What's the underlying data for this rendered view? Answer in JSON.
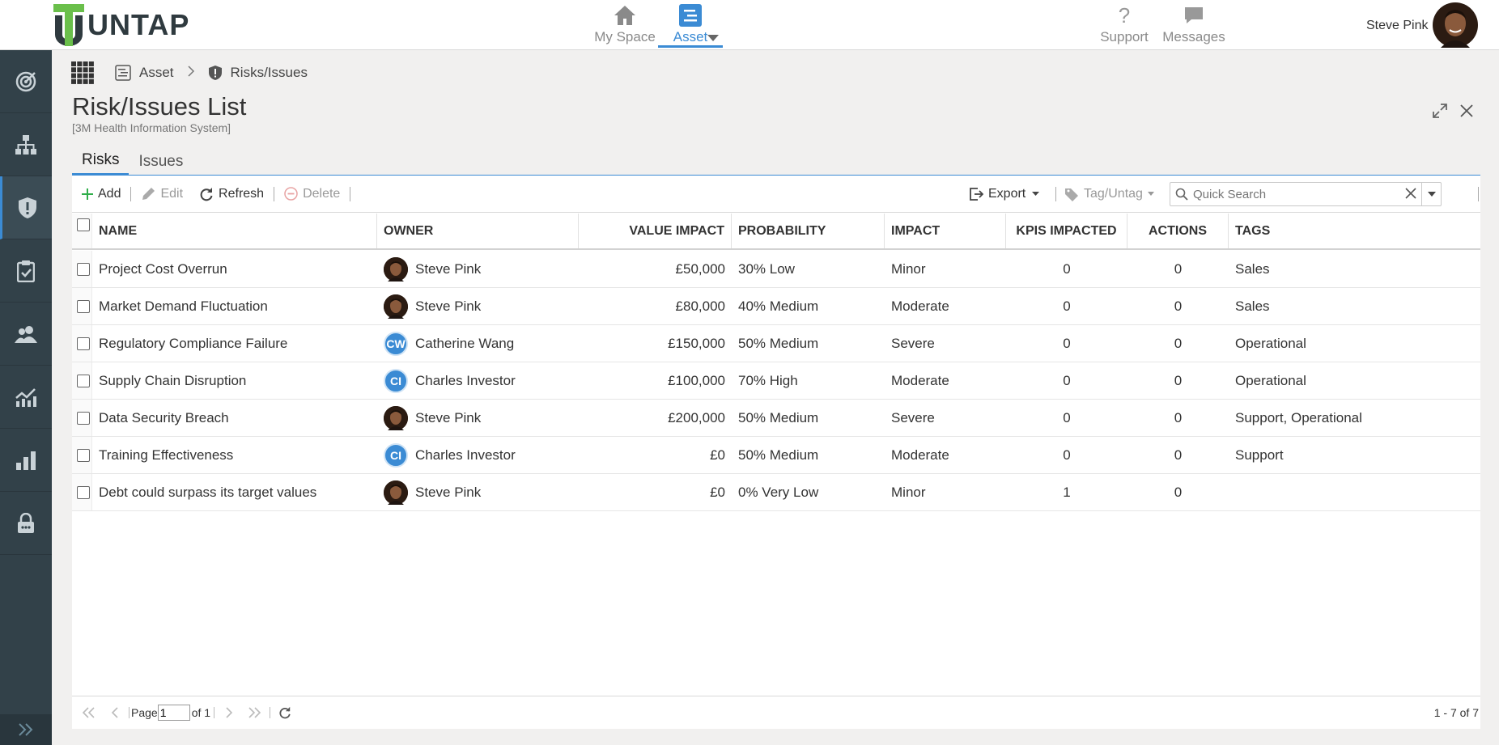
{
  "app": {
    "logo_text": "UNTAP"
  },
  "topnav": {
    "my_space": "My Space",
    "asset": "Asset",
    "support": "Support",
    "messages": "Messages"
  },
  "user": {
    "name": "Steve Pink"
  },
  "breadcrumb": {
    "level1": "Asset",
    "level2": "Risks/Issues"
  },
  "page": {
    "title": "Risk/Issues List",
    "subtitle": "[3M Health Information System]"
  },
  "tabs": [
    {
      "label": "Risks"
    },
    {
      "label": "Issues"
    }
  ],
  "toolbar": {
    "add": "Add",
    "edit": "Edit",
    "refresh": "Refresh",
    "delete": "Delete",
    "export": "Export",
    "tag_untag": "Tag/Untag",
    "search_placeholder": "Quick Search"
  },
  "columns": {
    "name": "NAME",
    "owner": "OWNER",
    "value_impact": "VALUE IMPACT",
    "probability": "PROBABILITY",
    "impact": "IMPACT",
    "kpis_impacted": "KPIS IMPACTED",
    "actions": "ACTIONS",
    "tags": "TAGS"
  },
  "rows": [
    {
      "name": "Project Cost Overrun",
      "owner": "Steve Pink",
      "owner_avatar": "photo",
      "value_impact": "£50,000",
      "probability": "30% Low",
      "impact": "Minor",
      "kpis": "0",
      "actions": "0",
      "tags": "Sales"
    },
    {
      "name": "Market Demand Fluctuation",
      "owner": "Steve Pink",
      "owner_avatar": "photo",
      "value_impact": "£80,000",
      "probability": "40% Medium",
      "impact": "Moderate",
      "kpis": "0",
      "actions": "0",
      "tags": "Sales"
    },
    {
      "name": "Regulatory Compliance Failure",
      "owner": "Catherine Wang",
      "owner_avatar": "CW",
      "value_impact": "£150,000",
      "probability": "50% Medium",
      "impact": "Severe",
      "kpis": "0",
      "actions": "0",
      "tags": "Operational"
    },
    {
      "name": "Supply Chain Disruption",
      "owner": "Charles Investor",
      "owner_avatar": "CI",
      "value_impact": "£100,000",
      "probability": "70% High",
      "impact": "Moderate",
      "kpis": "0",
      "actions": "0",
      "tags": "Operational"
    },
    {
      "name": "Data Security Breach",
      "owner": "Steve Pink",
      "owner_avatar": "photo",
      "value_impact": "£200,000",
      "probability": "50% Medium",
      "impact": "Severe",
      "kpis": "0",
      "actions": "0",
      "tags": "Support, Operational"
    },
    {
      "name": "Training Effectiveness",
      "owner": "Charles Investor",
      "owner_avatar": "CI",
      "value_impact": "£0",
      "probability": "50% Medium",
      "impact": "Moderate",
      "kpis": "0",
      "actions": "0",
      "tags": "Support"
    },
    {
      "name": "Debt could surpass its target values",
      "owner": "Steve Pink",
      "owner_avatar": "photo",
      "value_impact": "£0",
      "probability": "0% Very Low",
      "impact": "Minor",
      "kpis": "1",
      "actions": "0",
      "tags": ""
    }
  ],
  "pager": {
    "page_label": "Page",
    "page_value": "1",
    "of_label": "of 1",
    "info": "1 - 7 of 7"
  },
  "colors": {
    "accent": "#3b8bd4",
    "sidebar": "#324149",
    "logo_green": "#6abf4b"
  }
}
